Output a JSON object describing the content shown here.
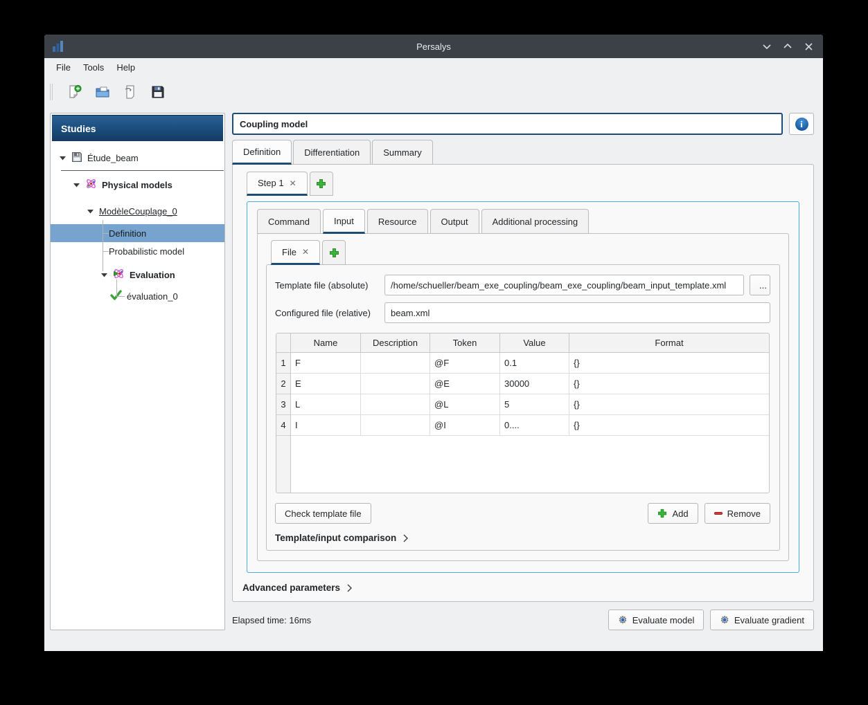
{
  "window": {
    "title": "Persalys"
  },
  "menubar": {
    "items": [
      {
        "label": "File"
      },
      {
        "label": "Tools"
      },
      {
        "label": "Help"
      }
    ]
  },
  "toolbar": {
    "buttons": [
      {
        "name": "new-study-icon"
      },
      {
        "name": "open-study-icon"
      },
      {
        "name": "import-script-icon"
      },
      {
        "name": "save-study-icon"
      }
    ]
  },
  "sidebar": {
    "header": "Studies",
    "tree": [
      {
        "label": "Étude_beam"
      },
      {
        "label": "Physical models"
      },
      {
        "label": "ModèleCouplage_0"
      },
      {
        "label": "Definition",
        "selected": true
      },
      {
        "label": "Probabilistic model"
      },
      {
        "label": "Evaluation"
      },
      {
        "label": "évaluation_0"
      }
    ]
  },
  "main": {
    "model_name": "Coupling model",
    "tabs": [
      {
        "label": "Definition",
        "active": true
      },
      {
        "label": "Differentiation"
      },
      {
        "label": "Summary"
      }
    ],
    "step_tab": {
      "label": "Step 1",
      "close": "✕"
    },
    "inner_tabs": [
      {
        "label": "Command"
      },
      {
        "label": "Input",
        "active": true
      },
      {
        "label": "Resource"
      },
      {
        "label": "Output"
      },
      {
        "label": "Additional processing"
      }
    ],
    "file_tab": {
      "label": "File",
      "close": "✕"
    },
    "fields": {
      "template_label": "Template file (absolute)",
      "template_value": "/home/schueller/beam_exe_coupling/beam_exe_coupling/beam_input_template.xml",
      "browse_label": "...",
      "configured_label": "Configured file (relative)",
      "configured_value": "beam.xml"
    },
    "table": {
      "headers": [
        "Name",
        "Description",
        "Token",
        "Value",
        "Format"
      ],
      "rows": [
        {
          "num": "1",
          "name": "F",
          "description": "",
          "token": "@F",
          "value": "0.1",
          "format": "{}"
        },
        {
          "num": "2",
          "name": "E",
          "description": "",
          "token": "@E",
          "value": "30000",
          "format": "{}"
        },
        {
          "num": "3",
          "name": "L",
          "description": "",
          "token": "@L",
          "value": "5",
          "format": "{}"
        },
        {
          "num": "4",
          "name": "I",
          "description": "",
          "token": "@I",
          "value": "0....",
          "format": "{}"
        }
      ]
    },
    "buttons": {
      "check_template": "Check template file",
      "add": "Add",
      "remove": "Remove"
    },
    "comparison_label": "Template/input comparison",
    "advanced_label": "Advanced parameters",
    "status": "Elapsed time: 16ms",
    "evaluate_model": "Evaluate model",
    "evaluate_gradient": "Evaluate gradient"
  },
  "colors": {
    "accent_navy": "#1c4b75",
    "focus_blue_border": "#4aabe4",
    "tree_selection": "#77a4ce",
    "studies_header_top": "#2a6294",
    "studies_header_bottom": "#143a63",
    "titlebar": "#3b4147",
    "add_green": "#3cb43c",
    "remove_red": "#d23b3b",
    "info_blue": "#15579d"
  }
}
